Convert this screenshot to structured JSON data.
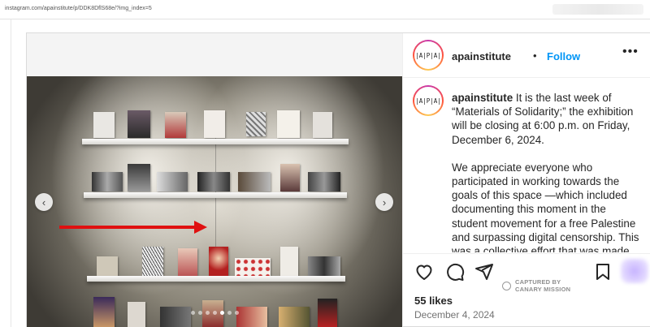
{
  "browser": {
    "url": "instagram.com/apainstitute/p/DDK8DflS68e/?img_index=5"
  },
  "post": {
    "avatar_text": "|A|P|A|",
    "username": "apainstitute",
    "separator": "•",
    "follow_label": "Follow",
    "more_icon": "more-horizontal-icon",
    "caption_username": "apainstitute",
    "caption_p1": "It is the last week of “Materials of Solidarity;” the exhibition will be closing at 6:00 p.m. on Friday, December 6, 2024.",
    "caption_p2": "We appreciate everyone who participated in working towards the goals of this space —which included documenting this moment in the student movement for a free Palestine and surpassing digital censorship. This was a collective effort that was made",
    "likes": "55 likes",
    "date": "December 4, 2024",
    "carousel": {
      "count": 7,
      "active_index": 4
    },
    "nav_prev": "‹",
    "nav_next": "›"
  },
  "watermark": {
    "line1": "CAPTURED BY",
    "line2": "CANARY MISSION"
  },
  "colors": {
    "follow": "#0095f6",
    "annotation_arrow": "#e01010"
  }
}
